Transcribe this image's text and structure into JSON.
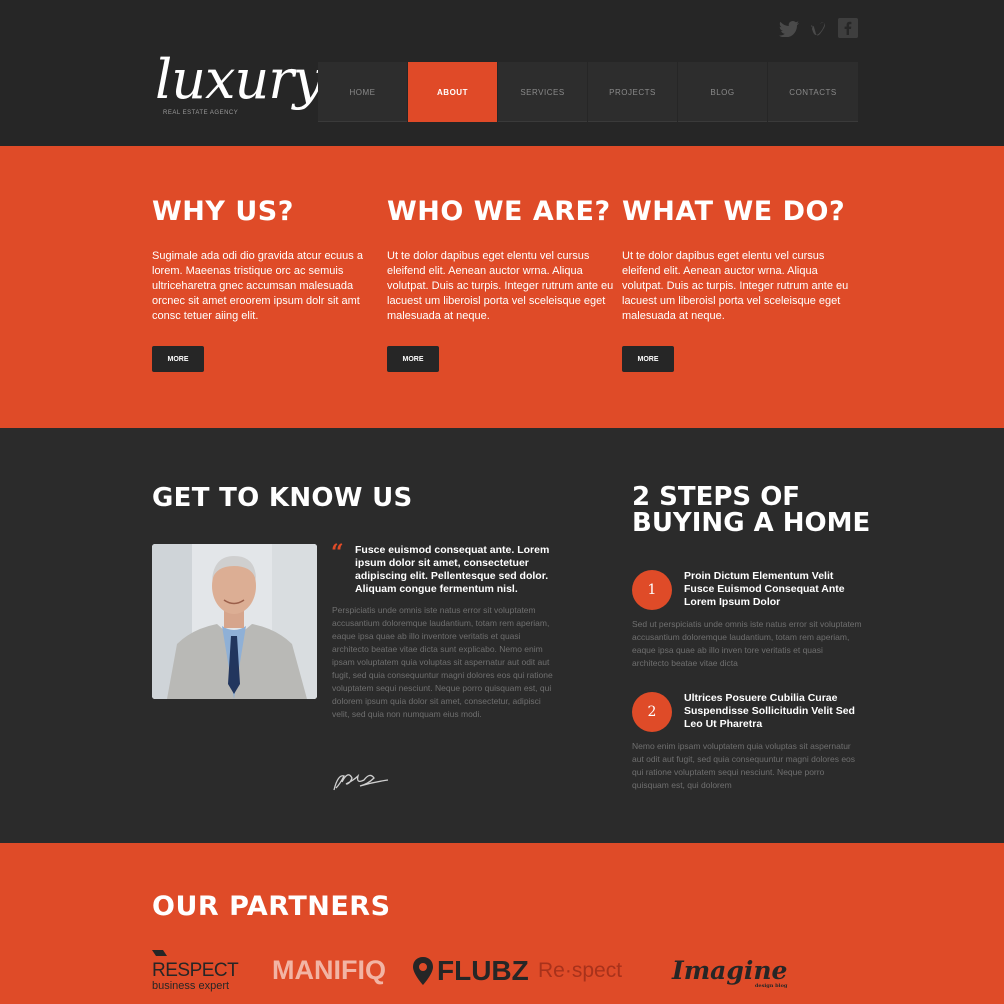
{
  "header": {
    "logo": "luxury",
    "logo_subtitle": "REAL ESTATE AGENCY",
    "social_icons": [
      "twitter-icon",
      "vimeo-icon",
      "facebook-icon"
    ],
    "nav": [
      {
        "label": "HOME",
        "active": false
      },
      {
        "label": "ABOUT",
        "active": true
      },
      {
        "label": "SERVICES",
        "active": false
      },
      {
        "label": "PROJECTS",
        "active": false
      },
      {
        "label": "BLOG",
        "active": false
      },
      {
        "label": "CONTACTS",
        "active": false
      }
    ]
  },
  "features": [
    {
      "title": "WHY US?",
      "text": "Sugimale ada odi dio gravida atcur ecuus a lorem. Maeenas tristique orc ac semuis ultriceharetra gnec accumsan malesuada orcnec sit amet eroorem ipsum dolr sit amt consc tetuer aiing elit.",
      "button": "MORE"
    },
    {
      "title": "WHO WE ARE?",
      "text": "Ut te dolor dapibus eget elentu vel cursus eleifend elit. Aenean auctor wrna. Aliqua volutpat. Duis ac turpis. Integer rutrum ante eu lacuest um liberoisl porta vel sceleisque eget malesuada at neque.",
      "button": "MORE"
    },
    {
      "title": "WHAT WE DO?",
      "text": "Ut te dolor dapibus eget elentu vel cursus eleifend elit. Aenean auctor wrna. Aliqua volutpat. Duis ac turpis. Integer rutrum ante eu lacuest um liberoisl porta vel sceleisque eget malesuada at neque.",
      "button": "MORE"
    }
  ],
  "know": {
    "title": "GET TO KNOW US",
    "quote": "Fusce euismod consequat ante. Lorem ipsum dolor sit amet, consectetuer adipiscing elit. Pellentesque sed dolor. Aliquam congue fermentum nisl.",
    "body": "Perspiciatis unde omnis iste natus error sit voluptatem accusantium doloremque laudantium, totam rem aperiam, eaque ipsa quae ab illo inventore veritatis et quasi architecto beatae vitae dicta sunt explicabo. Nemo enim ipsam voluptatem quia voluptas sit aspernatur aut odit aut fugit, sed quia consequuntur magni dolores eos qui ratione voluptatem sequi nesciunt. Neque porro quisquam est, qui dolorem ipsum quia dolor sit amet, consectetur, adipisci velit, sed quia non numquam eius modi."
  },
  "steps": {
    "title": "2 STEPS OF BUYING A HOME",
    "items": [
      {
        "num": "1",
        "title": "Proin Dictum Elementum Velit Fusce Euismod Consequat Ante Lorem Ipsum Dolor",
        "text": "Sed ut perspiciatis unde omnis iste natus error sit voluptatem accusantium doloremque laudantium, totam rem aperiam, eaque ipsa quae ab illo inven tore veritatis et quasi architecto beatae vitae dicta"
      },
      {
        "num": "2",
        "title": "Ultrices Posuere Cubilia Curae Suspendisse Sollicitudin Velit Sed Leo Ut Pharetra",
        "text": "Nemo enim ipsam voluptatem quia voluptas sit aspernatur aut odit aut fugit, sed quia consequuntur magni dolores eos qui ratione voluptatem sequi nesciunt. Neque porro quisquam est, qui dolorem"
      }
    ]
  },
  "partners": {
    "title": "OUR PARTNERS",
    "logos": [
      {
        "name": "RESPECT",
        "sub": "business expert"
      },
      {
        "name": "MANIFIQ"
      },
      {
        "name": "FLUBZ"
      },
      {
        "name": "Re·spect"
      },
      {
        "name": "Imagine",
        "sub": "design blog"
      }
    ]
  },
  "colors": {
    "accent": "#df4b28",
    "dark": "#2b2b2b",
    "header": "#262626"
  }
}
